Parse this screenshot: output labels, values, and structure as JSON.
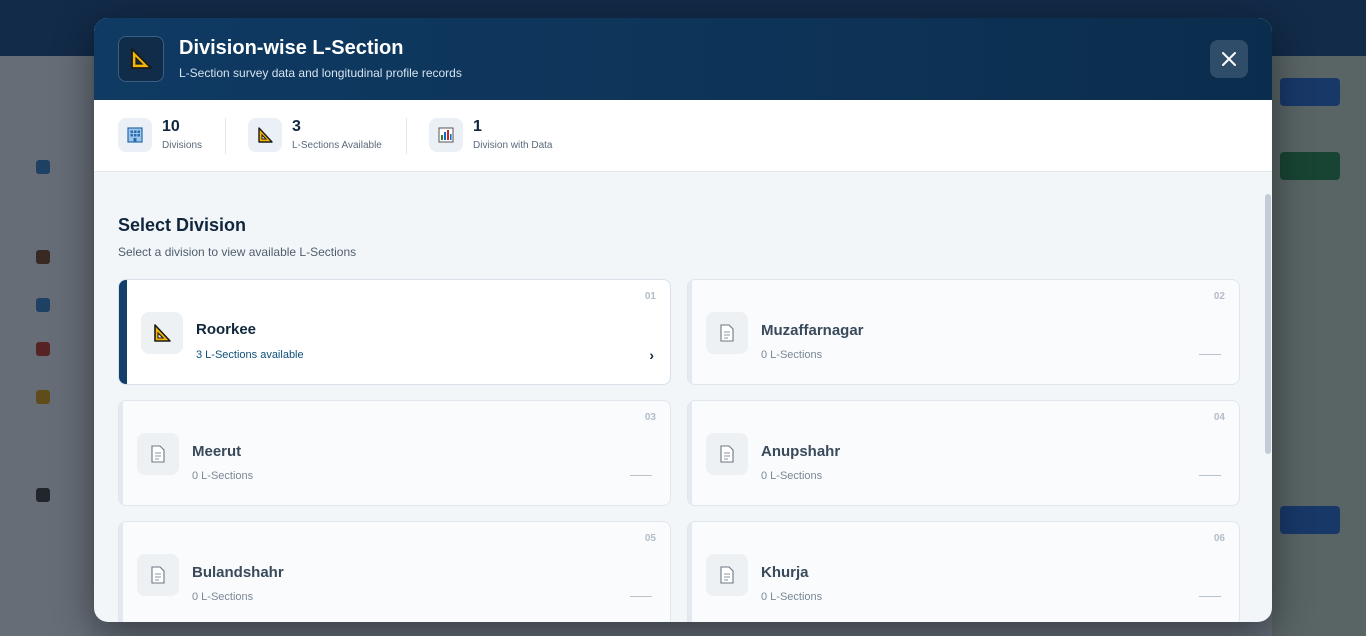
{
  "modal": {
    "title": "Division-wise L-Section",
    "subtitle": "L-Section survey data and longitudinal profile records",
    "header_icon": "set-square-icon",
    "close_icon": "close-icon"
  },
  "stats": [
    {
      "value": "10",
      "label": "Divisions",
      "icon": "building-icon"
    },
    {
      "value": "3",
      "label": "L-Sections Available",
      "icon": "set-square-icon"
    },
    {
      "value": "1",
      "label": "Division with Data",
      "icon": "bar-chart-icon"
    }
  ],
  "section": {
    "title": "Select Division",
    "subtitle": "Select a division to view available L-Sections"
  },
  "divisions": [
    {
      "num": "01",
      "name": "Roorkee",
      "count": "3 L-Sections available",
      "active": true,
      "icon": "set-square-icon"
    },
    {
      "num": "02",
      "name": "Muzaffarnagar",
      "count": "0 L-Sections",
      "active": false,
      "icon": "document-icon"
    },
    {
      "num": "03",
      "name": "Meerut",
      "count": "0 L-Sections",
      "active": false,
      "icon": "document-icon"
    },
    {
      "num": "04",
      "name": "Anupshahr",
      "count": "0 L-Sections",
      "active": false,
      "icon": "document-icon"
    },
    {
      "num": "05",
      "name": "Bulandshahr",
      "count": "0 L-Sections",
      "active": false,
      "icon": "document-icon"
    },
    {
      "num": "06",
      "name": "Khurja",
      "count": "0 L-Sections",
      "active": false,
      "icon": "document-icon"
    }
  ],
  "colors": {
    "header": "#0f3a63",
    "accent": "#123f6b",
    "set_square": "#f2b705"
  }
}
